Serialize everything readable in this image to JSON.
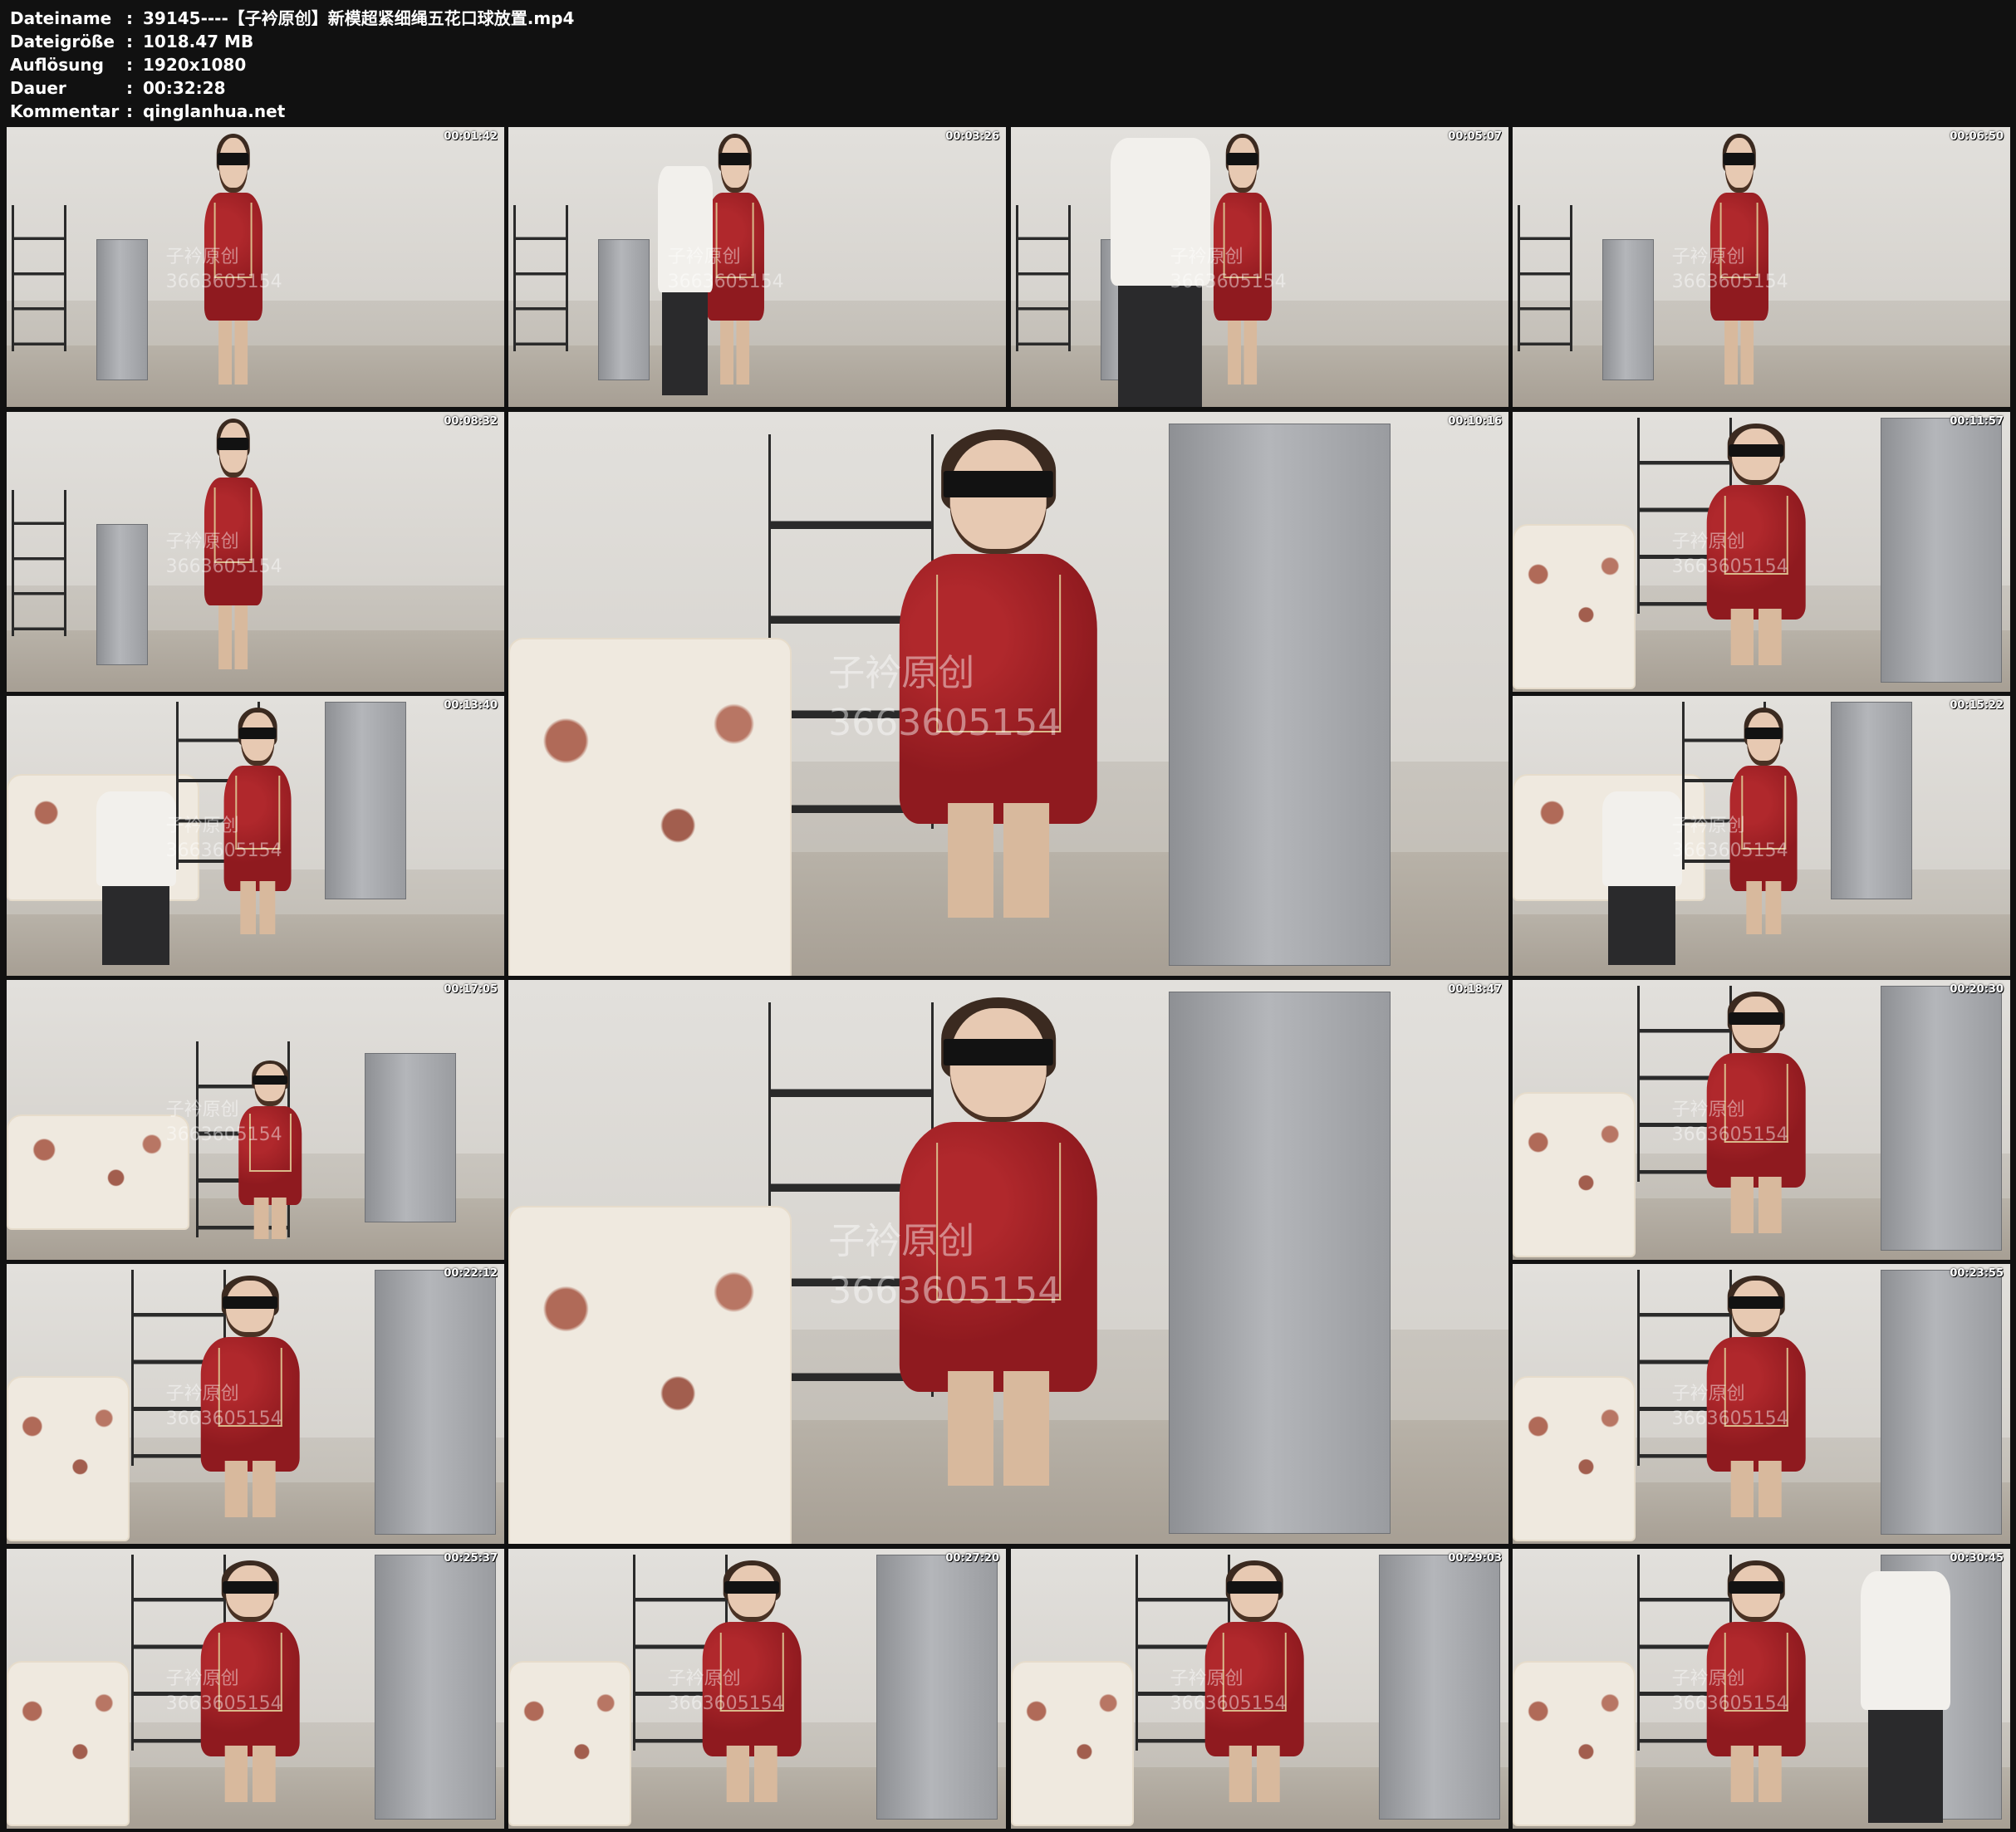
{
  "meta": {
    "filename_label": "Dateiname",
    "filename": "39145----【子衿原创】新模超紧细绳五花口球放置.mp4",
    "filesize_label": "Dateigröße",
    "filesize": "1018.47 MB",
    "resolution_label": "Auflösung",
    "resolution": "1920x1080",
    "duration_label": "Dauer",
    "duration": "00:32:28",
    "comment_label": "Kommentar",
    "comment": "qinglanhua.net",
    "separator": ":"
  },
  "thumbnails": [
    {
      "timestamp": "00:01:42",
      "wm_line1": "子衿原创",
      "wm_line2": "3663605154"
    },
    {
      "timestamp": "00:03:26",
      "wm_line1": "子衿原创",
      "wm_line2": "3663605154"
    },
    {
      "timestamp": "00:05:07",
      "wm_line1": "子衿原创",
      "wm_line2": "3663605154"
    },
    {
      "timestamp": "00:06:50",
      "wm_line1": "子衿原创",
      "wm_line2": "3663605154"
    },
    {
      "timestamp": "00:08:32",
      "wm_line1": "子衿原创",
      "wm_line2": "3663605154"
    },
    {
      "timestamp": "00:10:16",
      "wm_line1": "子衿原创",
      "wm_line2": "3663605154"
    },
    {
      "timestamp": "00:11:57",
      "wm_line1": "子衿原创",
      "wm_line2": "3663605154"
    },
    {
      "timestamp": "00:13:40",
      "wm_line1": "子衿原创",
      "wm_line2": "3663605154"
    },
    {
      "timestamp": "00:15:22",
      "wm_line1": "子衿原创",
      "wm_line2": "3663605154"
    },
    {
      "timestamp": "00:17:05",
      "wm_line1": "子衿原创",
      "wm_line2": "3663605154"
    },
    {
      "timestamp": "00:18:47",
      "wm_line1": "子衿原创",
      "wm_line2": "3663605154"
    },
    {
      "timestamp": "00:20:30",
      "wm_line1": "子衿原创",
      "wm_line2": "3663605154"
    },
    {
      "timestamp": "00:22:12",
      "wm_line1": "子衿原创",
      "wm_line2": "3663605154"
    },
    {
      "timestamp": "00:23:55",
      "wm_line1": "子衿原创",
      "wm_line2": "3663605154"
    },
    {
      "timestamp": "00:25:37",
      "wm_line1": "子衿原创",
      "wm_line2": "3663605154"
    },
    {
      "timestamp": "00:27:20",
      "wm_line1": "子衿原创",
      "wm_line2": "3663605154"
    },
    {
      "timestamp": "00:29:03",
      "wm_line1": "子衿原创",
      "wm_line2": "3663605154"
    },
    {
      "timestamp": "00:30:45",
      "wm_line1": "子衿原创",
      "wm_line2": "3663605154"
    }
  ]
}
